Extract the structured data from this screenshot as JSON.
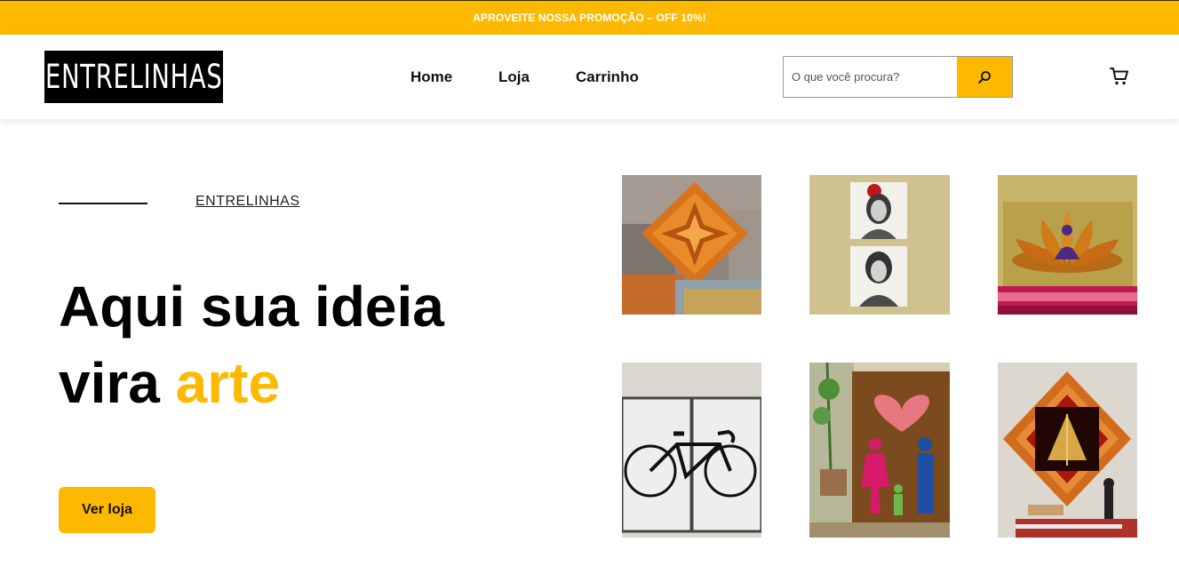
{
  "promo": {
    "text": "APROVEITE NOSSA PROMOÇÃO – OFF 10%!"
  },
  "header": {
    "logo_text": "ENTRELINHAS",
    "nav": [
      "Home",
      "Loja",
      "Carrinho"
    ],
    "search": {
      "placeholder": "O que você procura?",
      "value": "",
      "button_icon": "search-icon"
    },
    "cart_icon": "cart-icon"
  },
  "hero": {
    "eyebrow": "ENTRELINHAS",
    "title_line1": "Aqui sua ideia",
    "title_line2_prefix": "vira ",
    "title_line2_accent": "arte",
    "cta_label": "Ver loja"
  },
  "colors": {
    "accent": "#fdb900",
    "dark": "#000000",
    "text": "#111111"
  },
  "gallery": [
    {
      "subject": "orange-string-art-star"
    },
    {
      "subject": "frida-kahlo-portraits"
    },
    {
      "subject": "lotus-meditation-string-art"
    },
    {
      "subject": "bicycle-string-art"
    },
    {
      "subject": "family-heart-string-art"
    },
    {
      "subject": "mandala-figure-string-art"
    }
  ]
}
